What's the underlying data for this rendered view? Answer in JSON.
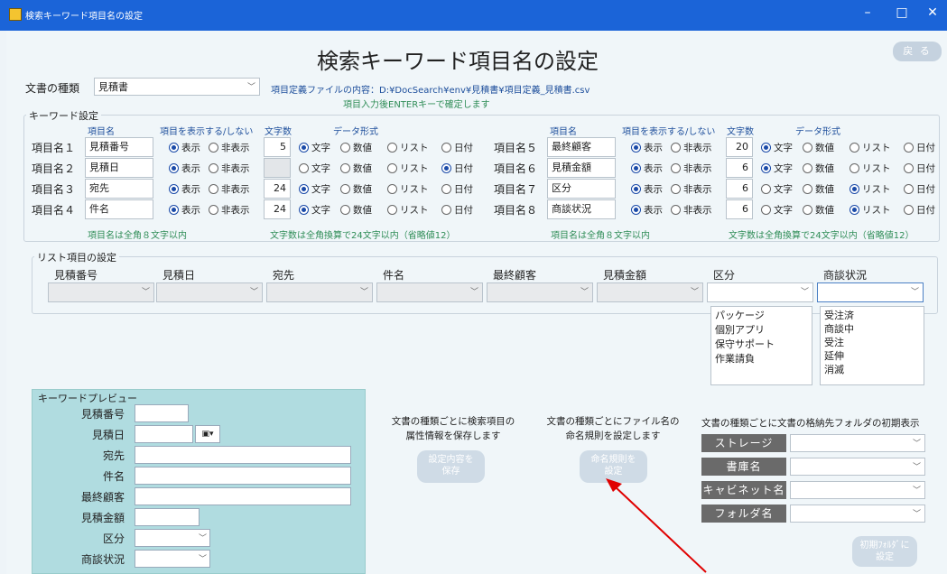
{
  "window": {
    "title": "検索キーワード項目名の設定",
    "min": "–",
    "max": "□",
    "close": "✕"
  },
  "page_title": "検索キーワード項目名の設定",
  "back_label": "戻 る",
  "doc_type": {
    "label": "文書の種類",
    "value": "見積書"
  },
  "def_file": {
    "label": "項目定義ファイルの内容：",
    "path": "D:¥DocSearch¥env¥見積書¥項目定義_見積書.csv",
    "hint": "項目入力後ENTERキーで確定します"
  },
  "keyword": {
    "section": "キーワード設定",
    "headers": {
      "name": "項目名",
      "show": "項目を表示する/しない",
      "len": "文字数",
      "fmt": "データ形式"
    },
    "opt": {
      "show": "表示",
      "hide": "非表示",
      "text": "文字",
      "num": "数値",
      "list": "リスト",
      "date": "日付"
    },
    "left": [
      {
        "label": "項目名１",
        "name": "見積番号",
        "len": "5"
      },
      {
        "label": "項目名２",
        "name": "見積日",
        "len": ""
      },
      {
        "label": "項目名３",
        "name": "宛先",
        "len": "24"
      },
      {
        "label": "項目名４",
        "name": "件名",
        "len": "24"
      }
    ],
    "right": [
      {
        "label": "項目名５",
        "name": "最終顧客",
        "len": "20"
      },
      {
        "label": "項目名６",
        "name": "見積金額",
        "len": "6"
      },
      {
        "label": "項目名７",
        "name": "区分",
        "len": "6"
      },
      {
        "label": "項目名８",
        "name": "商談状況",
        "len": "6"
      }
    ],
    "note_name": "項目名は全角８文字以内",
    "note_len": "文字数は全角換算で24文字以内（省略値12）"
  },
  "list_section": {
    "title": "リスト項目の設定",
    "cols": [
      "見積番号",
      "見積日",
      "宛先",
      "件名",
      "最終顧客",
      "見積金額",
      "区分",
      "商談状況"
    ],
    "kubun": [
      "パッケージ",
      "個別アプリ",
      "保守サポート",
      "作業請負"
    ],
    "shodan": [
      "受注済",
      "商談中",
      "受注",
      "延伸",
      "消滅"
    ]
  },
  "preview": {
    "title": "キーワードプレビュー",
    "labels": [
      "見積番号",
      "見積日",
      "宛先",
      "件名",
      "最終顧客",
      "見積金額",
      "区分",
      "商談状況"
    ]
  },
  "save": {
    "desc1": "文書の種類ごとに検索項目の",
    "desc2": "属性情報を保存します",
    "btn1": "設定内容を",
    "btn2": "保存"
  },
  "naming": {
    "desc1": "文書の種類ごとにファイル名の",
    "desc2": "命名規則を設定します",
    "btn1": "命名規則を",
    "btn2": "設定"
  },
  "folder": {
    "desc": "文書の種類ごとに文書の格納先フォルダの初期表示",
    "labels": [
      "ストレージ",
      "書庫名",
      "キャビネット名",
      "フォルダ名"
    ],
    "btn1": "初期ﾌｫﾙﾀﾞに",
    "btn2": "設定"
  },
  "colors": {
    "titlebar": "#1b64d8",
    "accent": "#1a4aa8",
    "preview_bg": "#b0dce0",
    "arrow": "#e00000"
  }
}
